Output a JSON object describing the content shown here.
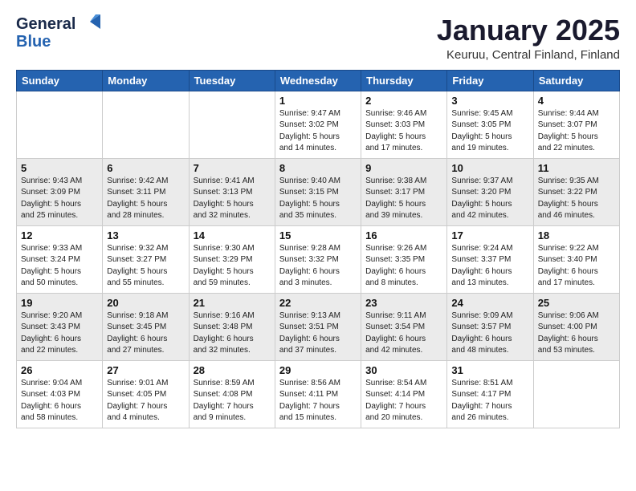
{
  "logo": {
    "general": "General",
    "blue": "Blue"
  },
  "title": "January 2025",
  "location": "Keuruu, Central Finland, Finland",
  "weekdays": [
    "Sunday",
    "Monday",
    "Tuesday",
    "Wednesday",
    "Thursday",
    "Friday",
    "Saturday"
  ],
  "weeks": [
    [
      {
        "day": "",
        "info": ""
      },
      {
        "day": "",
        "info": ""
      },
      {
        "day": "",
        "info": ""
      },
      {
        "day": "1",
        "info": "Sunrise: 9:47 AM\nSunset: 3:02 PM\nDaylight: 5 hours\nand 14 minutes."
      },
      {
        "day": "2",
        "info": "Sunrise: 9:46 AM\nSunset: 3:03 PM\nDaylight: 5 hours\nand 17 minutes."
      },
      {
        "day": "3",
        "info": "Sunrise: 9:45 AM\nSunset: 3:05 PM\nDaylight: 5 hours\nand 19 minutes."
      },
      {
        "day": "4",
        "info": "Sunrise: 9:44 AM\nSunset: 3:07 PM\nDaylight: 5 hours\nand 22 minutes."
      }
    ],
    [
      {
        "day": "5",
        "info": "Sunrise: 9:43 AM\nSunset: 3:09 PM\nDaylight: 5 hours\nand 25 minutes."
      },
      {
        "day": "6",
        "info": "Sunrise: 9:42 AM\nSunset: 3:11 PM\nDaylight: 5 hours\nand 28 minutes."
      },
      {
        "day": "7",
        "info": "Sunrise: 9:41 AM\nSunset: 3:13 PM\nDaylight: 5 hours\nand 32 minutes."
      },
      {
        "day": "8",
        "info": "Sunrise: 9:40 AM\nSunset: 3:15 PM\nDaylight: 5 hours\nand 35 minutes."
      },
      {
        "day": "9",
        "info": "Sunrise: 9:38 AM\nSunset: 3:17 PM\nDaylight: 5 hours\nand 39 minutes."
      },
      {
        "day": "10",
        "info": "Sunrise: 9:37 AM\nSunset: 3:20 PM\nDaylight: 5 hours\nand 42 minutes."
      },
      {
        "day": "11",
        "info": "Sunrise: 9:35 AM\nSunset: 3:22 PM\nDaylight: 5 hours\nand 46 minutes."
      }
    ],
    [
      {
        "day": "12",
        "info": "Sunrise: 9:33 AM\nSunset: 3:24 PM\nDaylight: 5 hours\nand 50 minutes."
      },
      {
        "day": "13",
        "info": "Sunrise: 9:32 AM\nSunset: 3:27 PM\nDaylight: 5 hours\nand 55 minutes."
      },
      {
        "day": "14",
        "info": "Sunrise: 9:30 AM\nSunset: 3:29 PM\nDaylight: 5 hours\nand 59 minutes."
      },
      {
        "day": "15",
        "info": "Sunrise: 9:28 AM\nSunset: 3:32 PM\nDaylight: 6 hours\nand 3 minutes."
      },
      {
        "day": "16",
        "info": "Sunrise: 9:26 AM\nSunset: 3:35 PM\nDaylight: 6 hours\nand 8 minutes."
      },
      {
        "day": "17",
        "info": "Sunrise: 9:24 AM\nSunset: 3:37 PM\nDaylight: 6 hours\nand 13 minutes."
      },
      {
        "day": "18",
        "info": "Sunrise: 9:22 AM\nSunset: 3:40 PM\nDaylight: 6 hours\nand 17 minutes."
      }
    ],
    [
      {
        "day": "19",
        "info": "Sunrise: 9:20 AM\nSunset: 3:43 PM\nDaylight: 6 hours\nand 22 minutes."
      },
      {
        "day": "20",
        "info": "Sunrise: 9:18 AM\nSunset: 3:45 PM\nDaylight: 6 hours\nand 27 minutes."
      },
      {
        "day": "21",
        "info": "Sunrise: 9:16 AM\nSunset: 3:48 PM\nDaylight: 6 hours\nand 32 minutes."
      },
      {
        "day": "22",
        "info": "Sunrise: 9:13 AM\nSunset: 3:51 PM\nDaylight: 6 hours\nand 37 minutes."
      },
      {
        "day": "23",
        "info": "Sunrise: 9:11 AM\nSunset: 3:54 PM\nDaylight: 6 hours\nand 42 minutes."
      },
      {
        "day": "24",
        "info": "Sunrise: 9:09 AM\nSunset: 3:57 PM\nDaylight: 6 hours\nand 48 minutes."
      },
      {
        "day": "25",
        "info": "Sunrise: 9:06 AM\nSunset: 4:00 PM\nDaylight: 6 hours\nand 53 minutes."
      }
    ],
    [
      {
        "day": "26",
        "info": "Sunrise: 9:04 AM\nSunset: 4:03 PM\nDaylight: 6 hours\nand 58 minutes."
      },
      {
        "day": "27",
        "info": "Sunrise: 9:01 AM\nSunset: 4:05 PM\nDaylight: 7 hours\nand 4 minutes."
      },
      {
        "day": "28",
        "info": "Sunrise: 8:59 AM\nSunset: 4:08 PM\nDaylight: 7 hours\nand 9 minutes."
      },
      {
        "day": "29",
        "info": "Sunrise: 8:56 AM\nSunset: 4:11 PM\nDaylight: 7 hours\nand 15 minutes."
      },
      {
        "day": "30",
        "info": "Sunrise: 8:54 AM\nSunset: 4:14 PM\nDaylight: 7 hours\nand 20 minutes."
      },
      {
        "day": "31",
        "info": "Sunrise: 8:51 AM\nSunset: 4:17 PM\nDaylight: 7 hours\nand 26 minutes."
      },
      {
        "day": "",
        "info": ""
      }
    ]
  ]
}
